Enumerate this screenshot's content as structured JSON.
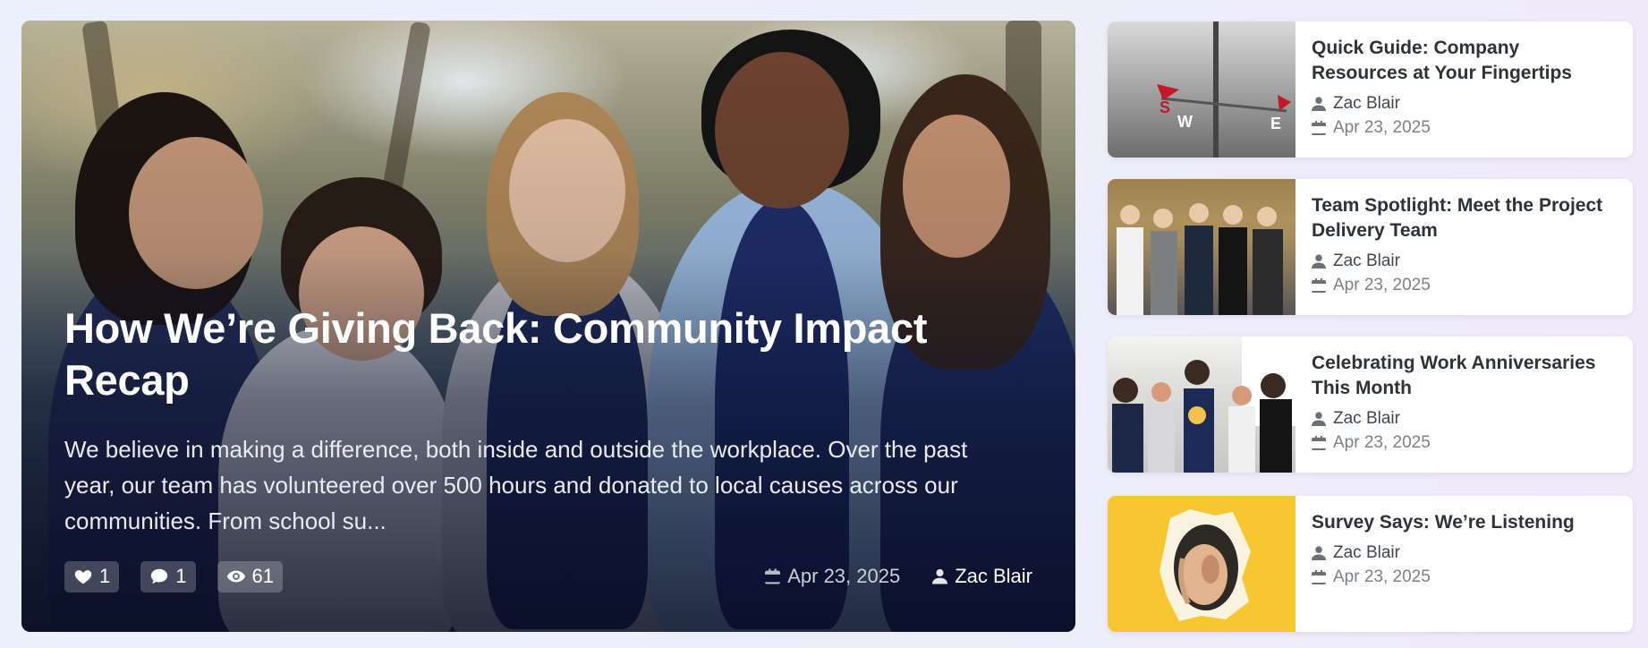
{
  "featured": {
    "title": "How We’re Giving Back: Community Impact Recap",
    "excerpt": "We believe in making a difference, both inside and outside the workplace. Over the past year, our team has volunteered over 500 hours and donated to local causes across our communities. From school su...",
    "likes": "1",
    "comments": "1",
    "views": "61",
    "date": "Apr 23, 2025",
    "author": "Zac Blair",
    "icons": {
      "likes": "heart-icon",
      "comments": "comment-icon",
      "views": "eye-icon",
      "date": "calendar-icon",
      "author": "user-icon"
    }
  },
  "side_posts": [
    {
      "title": "Quick Guide: Company Resources at Your Fingertips",
      "author": "Zac Blair",
      "date": "Apr 23, 2025"
    },
    {
      "title": "Team Spotlight: Meet the Project Delivery Team",
      "author": "Zac Blair",
      "date": "Apr 23, 2025"
    },
    {
      "title": "Celebrating Work Anniversaries This Month",
      "author": "Zac Blair",
      "date": "Apr 23, 2025"
    },
    {
      "title": "Survey Says: We’re Listening",
      "author": "Zac Blair",
      "date": "Apr 23, 2025"
    }
  ],
  "colors": {
    "title_dark": "#2f3237",
    "meta_gray": "#7c8088",
    "pill_bg": "rgba(255,255,255,0.22)",
    "survey_yellow": "#f7c731"
  }
}
